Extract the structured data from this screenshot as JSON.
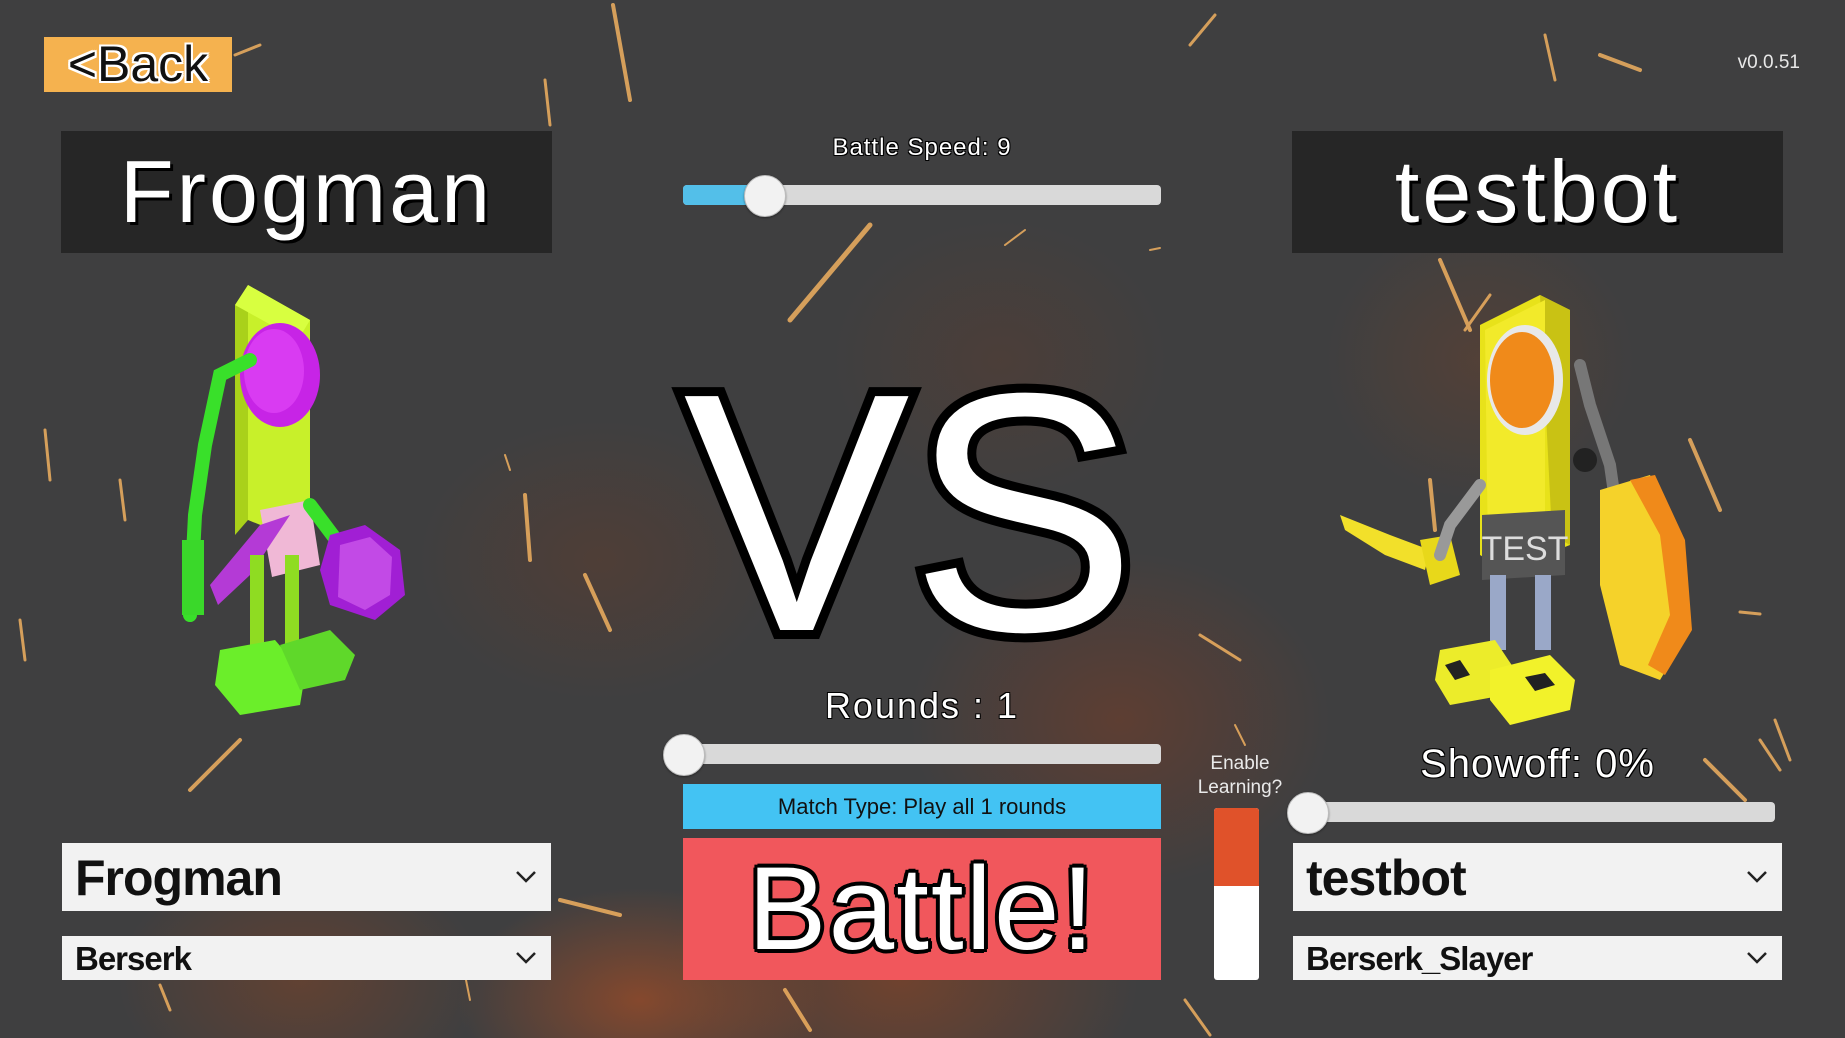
{
  "back_button": {
    "label": "<Back"
  },
  "version": "v0.0.51",
  "players": {
    "left": {
      "name": "Frogman",
      "bot_select": "Frogman",
      "strategy_select": "Berserk"
    },
    "right": {
      "name": "testbot",
      "bot_select": "testbot",
      "strategy_select": "Berserk_Slayer"
    }
  },
  "battle_speed": {
    "label": "Battle Speed: 9",
    "fraction": 0.17
  },
  "vs_text": "VS",
  "rounds": {
    "label": "Rounds : 1",
    "fraction": 0.0
  },
  "match_type": {
    "label": "Match Type: Play all 1 rounds"
  },
  "battle_button": {
    "label": "Battle!"
  },
  "learning": {
    "label_line1": "Enable",
    "label_line2": "Learning?",
    "enabled": true
  },
  "showoff": {
    "label": "Showoff: 0%",
    "fraction": 0.0
  },
  "colors": {
    "background": "#3f3f40",
    "back_button": "#f5b24f",
    "match_type": "#43c3f3",
    "battle_button": "#f1575c",
    "slider_fill": "#53bfe9",
    "toggle_on": "#e0522a"
  },
  "icons": {
    "dropdown": "chevron-down-icon"
  }
}
